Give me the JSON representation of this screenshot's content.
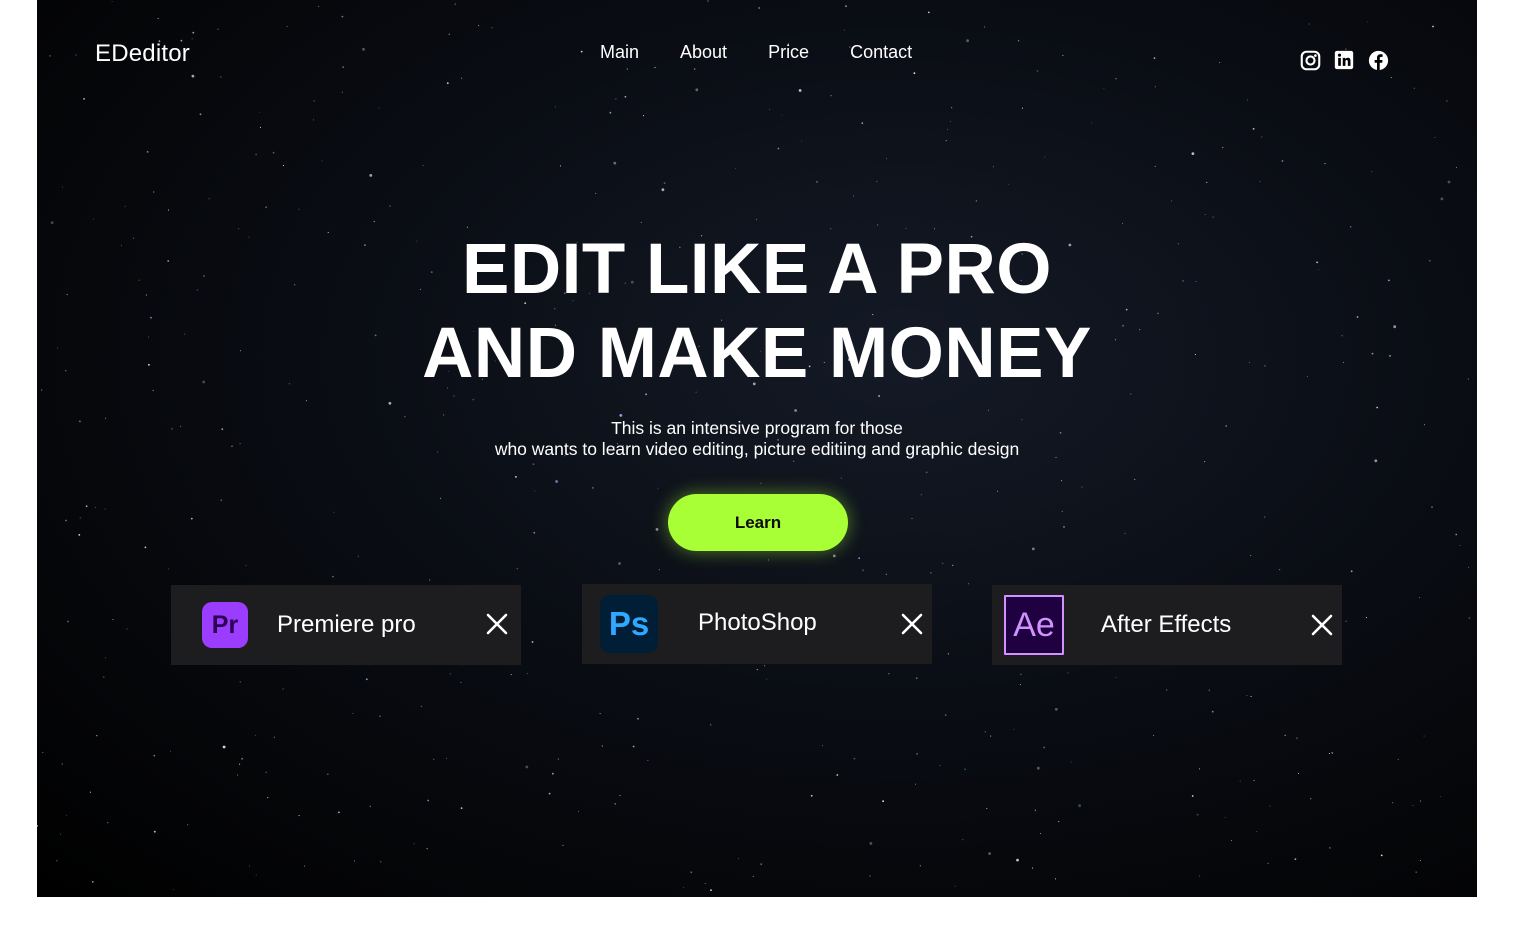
{
  "brand": {
    "name": "EDeditor"
  },
  "nav": {
    "items": [
      {
        "label": "Main"
      },
      {
        "label": "About"
      },
      {
        "label": "Price"
      },
      {
        "label": "Contact"
      }
    ]
  },
  "social": {
    "icons": [
      "instagram-icon",
      "linkedin-icon",
      "facebook-icon"
    ]
  },
  "hero": {
    "headline_line1": "EDIT LIKE A PRO",
    "headline_line2": "AND MAKE MONEY",
    "subtitle_line1": "This is an intensive program for those",
    "subtitle_line2": "who wants to learn video editing,  picture editiing and graphic design",
    "cta_label": "Learn"
  },
  "apps": [
    {
      "icon_text": "Pr",
      "name": "Premiere pro",
      "icon_bg": "#9b3dff",
      "icon_fg": "#2b0050"
    },
    {
      "icon_text": "Ps",
      "name": "PhotoShop",
      "icon_bg": "#001e36",
      "icon_fg": "#31a8ff"
    },
    {
      "icon_text": "Ae",
      "name": "After Effects",
      "icon_bg": "#1f0040",
      "icon_fg": "#d291ff"
    }
  ],
  "colors": {
    "accent": "#a8ff35",
    "card_bg": "#1d1d1f",
    "background": "#000000"
  }
}
